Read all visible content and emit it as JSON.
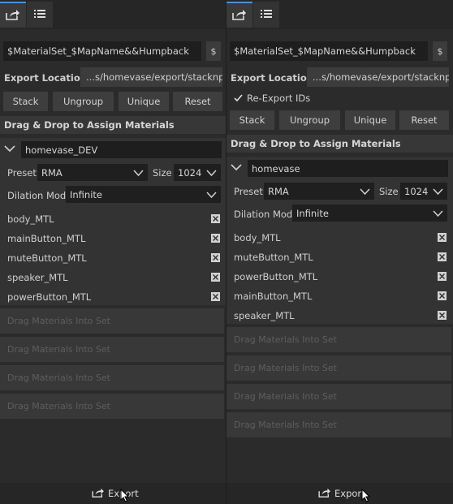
{
  "panels": {
    "left": {
      "name_template": "$MaterialSet_$MapName&&Humpback",
      "dollar_button": "$",
      "export_location_label": "Export Location",
      "export_location_path": "...s/homevase/export/stacknpack",
      "buttons": [
        "Stack",
        "Ungroup",
        "Unique",
        "Reset"
      ],
      "section_title": "Drag & Drop to Assign Materials",
      "set": {
        "name": "homevase_DEV",
        "preset_label": "Preset",
        "preset_value": "RMA",
        "size_label": "Size",
        "size_value": "1024",
        "dilation_label": "Dilation Mode",
        "dilation_value": "Infinite",
        "materials": [
          "body_MTL",
          "mainButton_MTL",
          "muteButton_MTL",
          "speaker_MTL",
          "powerButton_MTL"
        ]
      },
      "drop_zones": [
        "Drag Materials Into Set",
        "Drag Materials Into Set",
        "Drag Materials Into Set",
        "Drag Materials Into Set"
      ],
      "export_label": "Export"
    },
    "right": {
      "name_template": "$MaterialSet_$MapName&&Humpback",
      "dollar_button": "$",
      "export_location_label": "Export Location",
      "export_location_path": "...s/homevase/export/stacknpack",
      "reexport_label": "Re-Export IDs",
      "reexport_checked": true,
      "buttons": [
        "Stack",
        "Ungroup",
        "Unique",
        "Reset"
      ],
      "section_title": "Drag & Drop to Assign Materials",
      "set": {
        "name": "homevase",
        "preset_label": "Preset",
        "preset_value": "RMA",
        "size_label": "Size",
        "size_value": "1024",
        "dilation_label": "Dilation Mode",
        "dilation_value": "Infinite",
        "materials": [
          "body_MTL",
          "muteButton_MTL",
          "powerButton_MTL",
          "mainButton_MTL",
          "speaker_MTL"
        ]
      },
      "drop_zones": [
        "Drag Materials Into Set",
        "Drag Materials Into Set",
        "Drag Materials Into Set",
        "Drag Materials Into Set"
      ],
      "export_label": "Export"
    }
  },
  "icons": {
    "tab1": "export-icon",
    "tab2": "list-icon",
    "remove": "close-icon",
    "collapse": "chevron-down-icon",
    "checkbox": "checkmark-icon"
  },
  "colors": {
    "background": "#2b2b2b",
    "tab_accent": "#4a90d9",
    "field_bg": "#1e1e1e",
    "button_bg": "#3e3e3e"
  }
}
